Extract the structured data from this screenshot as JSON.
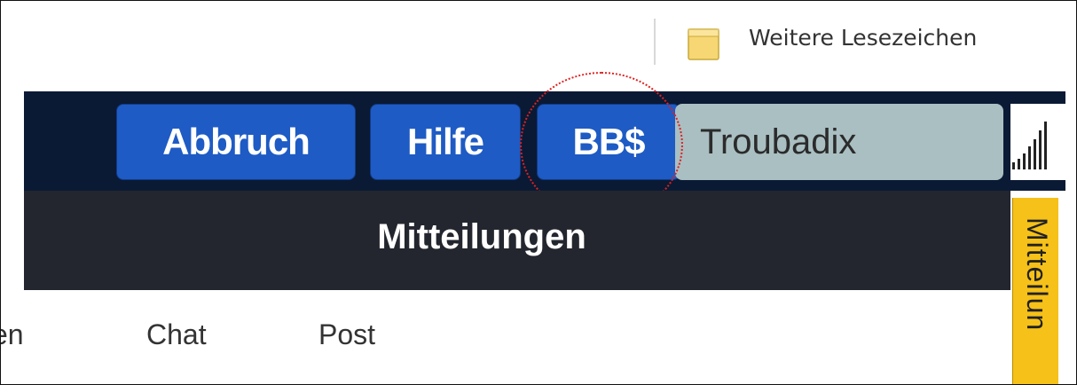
{
  "bookmarks_bar": {
    "other_bookmarks_label": "Weitere Lesezeichen",
    "folder_icon": "folder-icon"
  },
  "header": {
    "abbruch_label": "Abbruch",
    "hilfe_label": "Hilfe",
    "bbs_label": "BB$",
    "username": "Troubadix",
    "signal_icon": "signal-strength-icon"
  },
  "title_bar": {
    "title": "Mitteilungen"
  },
  "tabs": {
    "cut_label": "en",
    "chat_label": "Chat",
    "post_label": "Post"
  },
  "side_tab": {
    "label": "Mitteilun"
  },
  "colors": {
    "header_bg": "#0a1a34",
    "button_blue": "#1e5bc4",
    "user_field_bg": "#aabfc2",
    "title_bar_bg": "#23262e",
    "side_tab_yellow": "#f6c118",
    "highlight_red": "#e02020"
  }
}
